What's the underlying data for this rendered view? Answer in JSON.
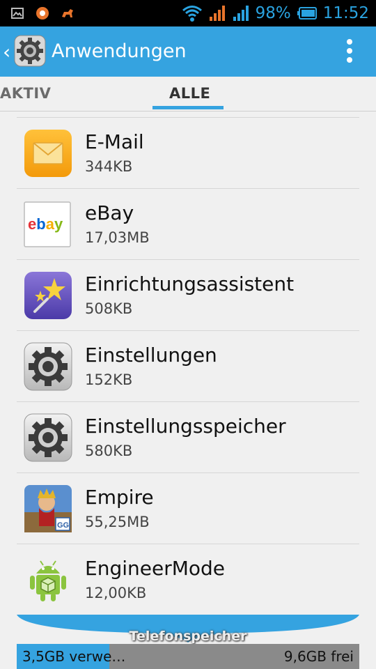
{
  "status_bar": {
    "battery_percent": "98%",
    "time": "11:52",
    "icons": [
      "gallery-notification-icon",
      "app-notification-icon",
      "animal-notification-icon",
      "wifi-icon",
      "signal-icon-1",
      "signal-icon-2",
      "battery-icon"
    ]
  },
  "action_bar": {
    "title": "Anwendungen",
    "back_icon": "chevron-left-icon",
    "app_icon": "settings-gear-icon",
    "overflow_icon": "overflow-menu-icon"
  },
  "tabs": {
    "aktiv": "AKTIV",
    "alle": "ALLE",
    "selected": "ALLE"
  },
  "apps": [
    {
      "name": "E-Mail",
      "size": "344KB",
      "icon": "email-app-icon"
    },
    {
      "name": "eBay",
      "size": "17,03MB",
      "icon": "ebay-app-icon"
    },
    {
      "name": "Einrichtungsassistent",
      "size": "508KB",
      "icon": "setup-wizard-icon"
    },
    {
      "name": "Einstellungen",
      "size": "152KB",
      "icon": "settings-gear-icon"
    },
    {
      "name": "Einstellungsspeicher",
      "size": "580KB",
      "icon": "settings-gear-icon"
    },
    {
      "name": "Empire",
      "size": "55,25MB",
      "icon": "empire-game-icon"
    },
    {
      "name": "EngineerMode",
      "size": "12,00KB",
      "icon": "android-app-icon"
    }
  ],
  "storage": {
    "label": "Telefonspeicher",
    "used": "3,5GB verwe…",
    "free": "9,6GB frei",
    "used_fraction": 0.27
  },
  "colors": {
    "accent": "#35a3e0",
    "status_text": "#2aa3e0",
    "storage_free": "#8a8a8a"
  }
}
